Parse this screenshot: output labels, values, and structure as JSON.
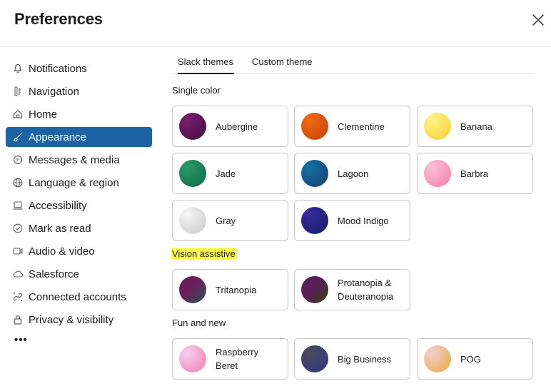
{
  "header": {
    "title": "Preferences"
  },
  "sidebar": {
    "items": [
      {
        "label": "Notifications",
        "icon": "bell-icon",
        "active": false
      },
      {
        "label": "Navigation",
        "icon": "navigation-icon",
        "active": false
      },
      {
        "label": "Home",
        "icon": "home-icon",
        "active": false
      },
      {
        "label": "Appearance",
        "icon": "paintbrush-icon",
        "active": true
      },
      {
        "label": "Messages & media",
        "icon": "message-icon",
        "active": false
      },
      {
        "label": "Language & region",
        "icon": "globe-icon",
        "active": false
      },
      {
        "label": "Accessibility",
        "icon": "laptop-icon",
        "active": false
      },
      {
        "label": "Mark as read",
        "icon": "check-circle-icon",
        "active": false
      },
      {
        "label": "Audio & video",
        "icon": "video-icon",
        "active": false
      },
      {
        "label": "Salesforce",
        "icon": "cloud-icon",
        "active": false
      },
      {
        "label": "Connected accounts",
        "icon": "link-icon",
        "active": false
      },
      {
        "label": "Privacy & visibility",
        "icon": "lock-icon",
        "active": false
      }
    ],
    "more_label": "•••"
  },
  "tabs": [
    {
      "label": "Slack themes",
      "active": true
    },
    {
      "label": "Custom theme",
      "active": false
    }
  ],
  "sections": [
    {
      "title": "Single color",
      "highlighted": false,
      "themes": [
        {
          "name": "Aubergine",
          "colors": [
            "#7a1f6e",
            "#3f0e40"
          ]
        },
        {
          "name": "Clementine",
          "colors": [
            "#f06a10",
            "#c2400a"
          ]
        },
        {
          "name": "Banana",
          "colors": [
            "#fff38a",
            "#f7cf2e"
          ]
        },
        {
          "name": "Jade",
          "colors": [
            "#2a9a6a",
            "#0f6a44"
          ]
        },
        {
          "name": "Lagoon",
          "colors": [
            "#1274a8",
            "#1c3c6a"
          ]
        },
        {
          "name": "Barbra",
          "colors": [
            "#ffc2d5",
            "#f27ba8"
          ]
        },
        {
          "name": "Gray",
          "colors": [
            "#f6f6f6",
            "#c9c9c9"
          ]
        },
        {
          "name": "Mood Indigo",
          "colors": [
            "#3a2c9a",
            "#101c6a"
          ]
        }
      ]
    },
    {
      "title": "Vision assistive",
      "highlighted": true,
      "themes": [
        {
          "name": "Tritanopia",
          "colors": [
            "#6a1f58",
            "#1f5a52"
          ]
        },
        {
          "name": "Protanopia & Deuteranopia",
          "colors": [
            "#5a1f56",
            "#2e4412"
          ]
        }
      ]
    },
    {
      "title": "Fun and new",
      "highlighted": false,
      "themes": [
        {
          "name": "Raspberry Beret",
          "colors": [
            "#f5d0f2",
            "#f57ab0"
          ]
        },
        {
          "name": "Big Business",
          "colors": [
            "#4a4a5a",
            "#2c3a8a"
          ]
        },
        {
          "name": "POG",
          "colors": [
            "#f5cdd2",
            "#e9a83a"
          ]
        }
      ]
    }
  ]
}
